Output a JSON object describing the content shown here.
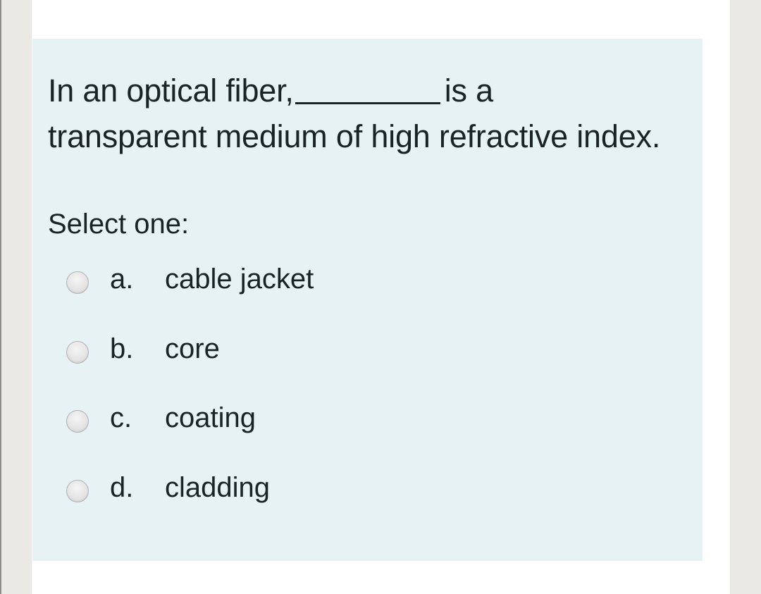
{
  "question": {
    "text_before_blank": "In an optical fiber,",
    "text_after_blank": "is a transparent medium of high refractive index.",
    "blank_label": "answer blank"
  },
  "prompt": "Select one:",
  "options": [
    {
      "letter": "a.",
      "text": "cable jacket",
      "selected": false
    },
    {
      "letter": "b.",
      "text": "core",
      "selected": false
    },
    {
      "letter": "c.",
      "text": "coating",
      "selected": false
    },
    {
      "letter": "d.",
      "text": "cladding",
      "selected": false
    }
  ],
  "colors": {
    "panel_background": "#e7f2f5",
    "text": "#1a2326",
    "side_strip": "#ebe9e5",
    "page_background": "#ffffff"
  }
}
